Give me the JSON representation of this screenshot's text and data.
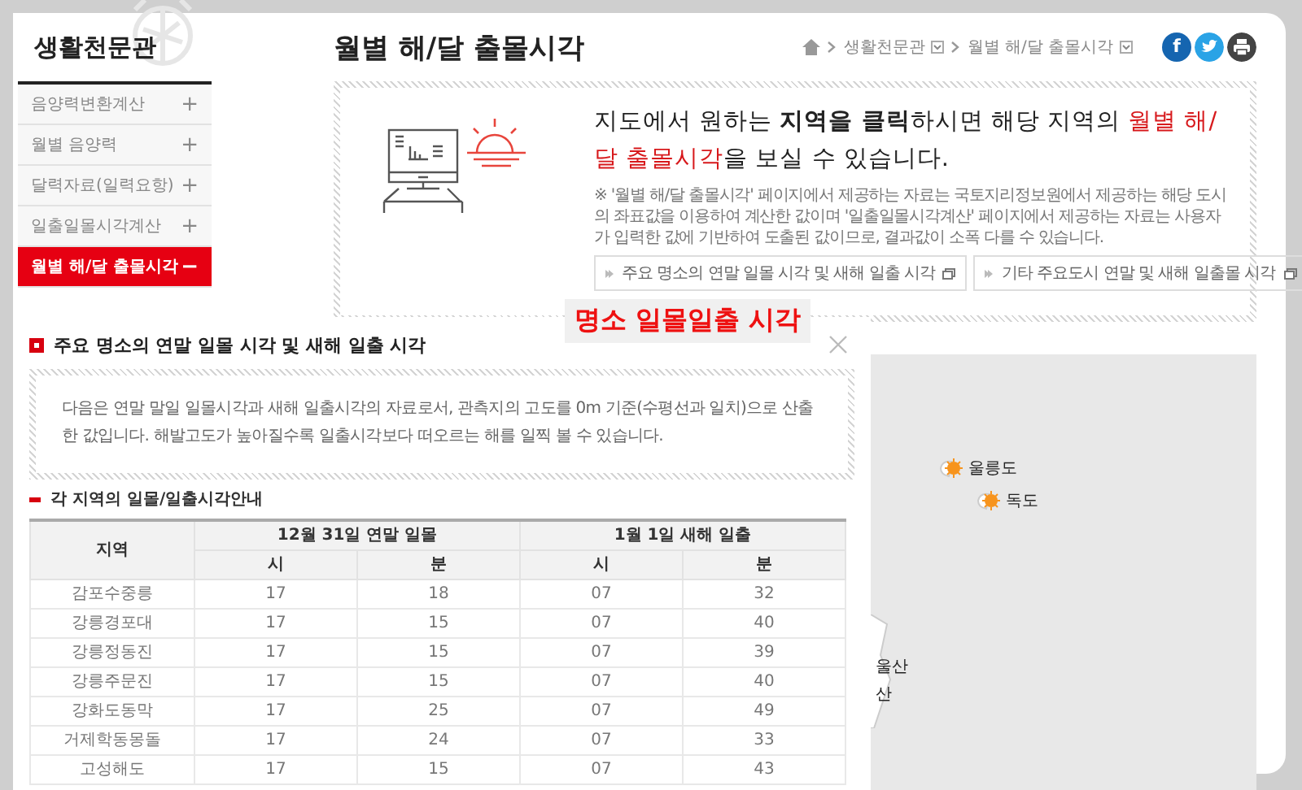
{
  "sidebar": {
    "title": "생활천문관",
    "items": [
      {
        "label": "음양력변환계산",
        "toggle": "+",
        "selected": false
      },
      {
        "label": "월별 음양력",
        "toggle": "+",
        "selected": false
      },
      {
        "label": "달력자료(일력요항)",
        "toggle": "+",
        "selected": false
      },
      {
        "label": "일출일몰시각계산",
        "toggle": "+",
        "selected": false
      },
      {
        "label": "월별 해/달 출몰시각",
        "toggle": "−",
        "selected": true
      }
    ]
  },
  "page_title": "월별 해/달 출몰시각",
  "breadcrumb": [
    {
      "label": "생활천문관"
    },
    {
      "label": "월별 해/달 출몰시각"
    }
  ],
  "share": [
    {
      "kind": "facebook",
      "glyph": "f"
    },
    {
      "kind": "twitter"
    },
    {
      "kind": "print"
    }
  ],
  "intro": {
    "headline": [
      {
        "kind": "plain",
        "text": "지도에서 원하는 "
      },
      {
        "kind": "bold",
        "text": "지역을 클릭"
      },
      {
        "kind": "plain",
        "text": "하시면 해당 지역의 "
      },
      {
        "kind": "accent",
        "text": "월별 해/달 출몰시각"
      },
      {
        "kind": "plain",
        "text": "을 보실 수 있습니다."
      }
    ],
    "note": "※ '월별 해/달 출몰시각' 페이지에서 제공하는 자료는 국토지리정보원에서 제공하는 해당 도시의 좌표값을 이용하여 계산한 값이며 '일출일몰시각계산' 페이지에서 제공하는 자료는 사용자가 입력한 값에 기반하여 도출된 값이므로, 결과값이 소폭 다를 수 있습니다.",
    "links": [
      {
        "label": "주요 명소의 연말 일몰 시각 및 새해 일출 시각"
      },
      {
        "label": "기타 주요도시 연말 및 새해 일출몰 시각"
      }
    ]
  },
  "map": {
    "labels": [
      {
        "kind": "sun",
        "text": "울릉도"
      },
      {
        "kind": "sun",
        "text": "독도"
      },
      {
        "kind": "plain",
        "text": "울산"
      },
      {
        "kind": "plain",
        "text": "산"
      }
    ]
  },
  "overlay_label": "명소 일몰일출 시각",
  "popup": {
    "title": "주요 명소의 연말 일몰 시각 및 새해 일출 시각",
    "description": "다음은 연말 말일 일몰시각과 새해 일출시각의 자료로서, 관측지의 고도를 0m 기준(수평선과 일치)으로 산출한 값입니다. 해발고도가 높아질수록 일출시각보다 떠오르는 해를 일찍 볼 수 있습니다.",
    "section_title": "각 지역의 일몰/일출시각안내",
    "table": {
      "region_header": "지역",
      "groups": [
        {
          "label": "12월 31일 연말 일몰",
          "columns": [
            "시",
            "분"
          ]
        },
        {
          "label": "1월 1일 새해 일출",
          "columns": [
            "시",
            "분"
          ]
        }
      ],
      "rows": [
        [
          "감포수중릉",
          "17",
          "18",
          "07",
          "32"
        ],
        [
          "강릉경포대",
          "17",
          "15",
          "07",
          "40"
        ],
        [
          "강릉정동진",
          "17",
          "15",
          "07",
          "39"
        ],
        [
          "강릉주문진",
          "17",
          "15",
          "07",
          "40"
        ],
        [
          "강화도동막",
          "17",
          "25",
          "07",
          "49"
        ],
        [
          "거제학동몽돌",
          "17",
          "24",
          "07",
          "33"
        ],
        [
          "고성해도",
          "17",
          "15",
          "07",
          "43"
        ]
      ]
    }
  }
}
